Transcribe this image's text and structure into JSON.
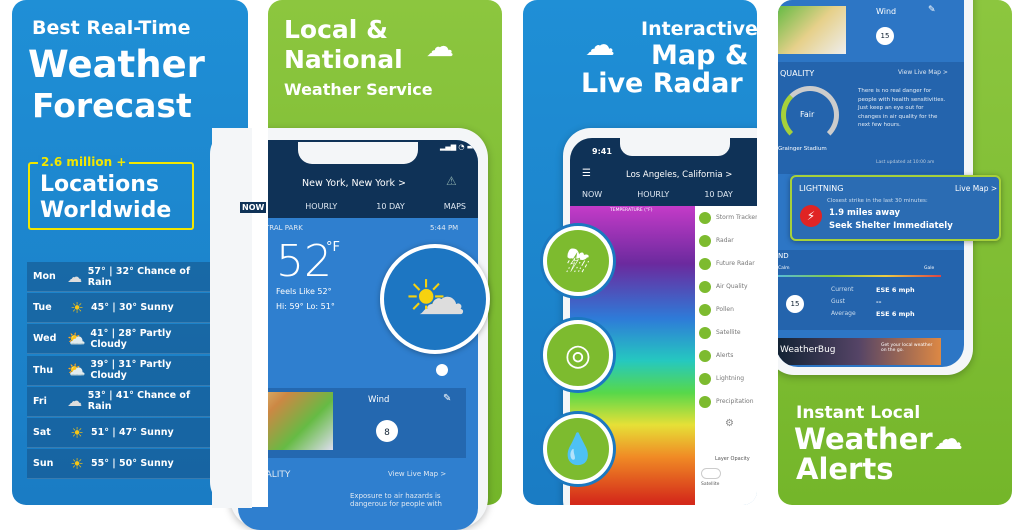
{
  "colors": {
    "blue": "#1f8fd6",
    "green": "#8cc63f",
    "accent_yellow": "#f2e600",
    "lightning_red": "#e02424"
  },
  "panel1": {
    "title": [
      "Best Real-Time",
      "Weather",
      "Forecast"
    ],
    "badge": {
      "top": "2.6 million +",
      "line1": "Locations",
      "line2": "Worldwide"
    },
    "forecast": [
      {
        "day": "Mon",
        "icon": "rain-cloud-icon",
        "text": "57° | 32° Chance of Rain"
      },
      {
        "day": "Tue",
        "icon": "sun-icon",
        "text": "45° | 30° Sunny"
      },
      {
        "day": "Wed",
        "icon": "partly-cloudy-icon",
        "text": "41° | 28° Partly Cloudy"
      },
      {
        "day": "Thu",
        "icon": "partly-cloudy-icon",
        "text": "39° | 31° Partly Cloudy"
      },
      {
        "day": "Fri",
        "icon": "rain-cloud-icon",
        "text": "53° | 41° Chance of Rain"
      },
      {
        "day": "Sat",
        "icon": "sun-icon",
        "text": "51° | 47° Sunny"
      },
      {
        "day": "Sun",
        "icon": "sun-icon",
        "text": "55° | 50° Sunny"
      }
    ]
  },
  "panel2": {
    "title": [
      "Local &",
      "National",
      "Weather Service"
    ],
    "location": "New York, New York >",
    "tabs": [
      "NOW",
      "HOURLY",
      "10 DAY",
      "MAPS"
    ],
    "station": "NYC, CENTRAL PARK",
    "time": "5:44 PM",
    "temp": "52",
    "unit": "°F",
    "feels": "Feels Like 52°",
    "hilo": "Hi: 59° Lo: 51°",
    "wind_label": "Wind",
    "wind_speed": "8",
    "aq_label": "AIR QUALITY",
    "live_map": "View Live Map >",
    "aq_text": "Exposure to air hazards is dangerous for people with"
  },
  "panel3": {
    "title": [
      "Interactive",
      "Map &",
      "Live Radar"
    ],
    "status_time": "9:41",
    "location": "Los Angeles, California >",
    "tabs": [
      "NOW",
      "HOURLY",
      "10 DAY",
      "MA"
    ],
    "legend": "TEMPERATURE (°F)",
    "menu": [
      "Storm Tracker",
      "Radar",
      "Future Radar",
      "Air Quality",
      "Pollen",
      "Satellite",
      "Alerts",
      "Lightning",
      "Precipitation"
    ],
    "layer_opacity": "Layer Opacity",
    "toggle_label": "Satellite"
  },
  "panel4": {
    "title": [
      "Instant Local",
      "Weather",
      "Alerts"
    ],
    "wind_label": "Wind",
    "wind_speed": "15",
    "aq_label": "QUALITY",
    "live_map": "View Live Map >",
    "aq_value": "Fair",
    "aq_text": "There is no real danger for people with health sensitivities. Just keep an eye out for changes in air quality for the next few hours.",
    "aq_location": "Grainger Stadium",
    "updated": "Last updated at 10:00 am",
    "lightning": {
      "label": "LIGHTNING",
      "link": "Live Map >",
      "sub": "Closest strike in the last 30 minutes:",
      "distance": "1.9 miles away",
      "advice": "Seek Shelter Immediately"
    },
    "wind2": {
      "label": "ND",
      "calm": "Calm",
      "gale": "Gale",
      "speed": "15",
      "rows": [
        [
          "Current",
          "ESE 6 mph"
        ],
        [
          "Gust",
          "--"
        ],
        [
          "Average",
          "ESE 6 mph"
        ]
      ]
    },
    "ad": {
      "brand": "WeatherBug",
      "text": "Get your local weather on the go."
    }
  }
}
